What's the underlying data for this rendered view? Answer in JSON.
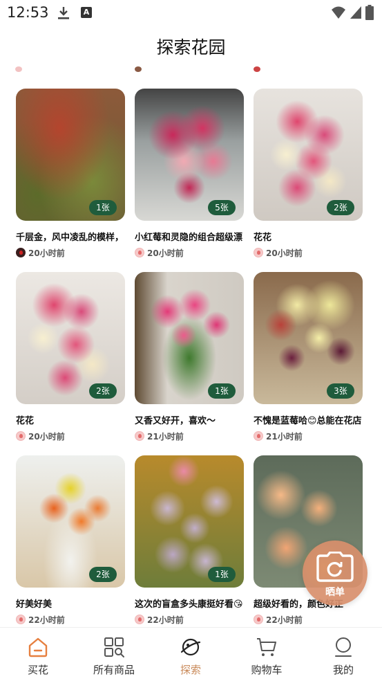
{
  "status_bar": {
    "time": "12:53",
    "notification_icons": [
      "download-icon",
      "a-icon"
    ],
    "system_icons": [
      "wifi-icon",
      "signal-icon",
      "battery-icon"
    ]
  },
  "header": {
    "title": "探索花园"
  },
  "posts": [
    {
      "title": "千层金，风中凌乱的模样，",
      "time": "20小时前",
      "count": "1张",
      "avatar": "dark"
    },
    {
      "title": "小红莓和灵隐的组合超级漂",
      "time": "20小时前",
      "count": "5张",
      "avatar": "pink"
    },
    {
      "title": "花花",
      "time": "20小时前",
      "count": "2张",
      "avatar": "pink"
    },
    {
      "title": "花花",
      "time": "20小时前",
      "count": "2张",
      "avatar": "pink"
    },
    {
      "title": "又香又好开，喜欢～",
      "time": "21小时前",
      "count": "1张",
      "avatar": "pink"
    },
    {
      "title": "不愧是蓝莓哈😊总能在花店",
      "time": "21小时前",
      "count": "3张",
      "avatar": "pink"
    },
    {
      "title": "好美好美",
      "time": "22小时前",
      "count": "2张",
      "avatar": "pink"
    },
    {
      "title": "这次的盲盒多头康挺好看😘",
      "time": "22小时前",
      "count": "1张",
      "avatar": "pink"
    },
    {
      "title": "超级好看的，颜色好正",
      "time": "22小时前",
      "count": "",
      "avatar": "pink"
    }
  ],
  "fab": {
    "label": "晒单",
    "icon": "camera-icon"
  },
  "tabs": [
    {
      "label": "买花",
      "icon": "home-icon",
      "active": false
    },
    {
      "label": "所有商品",
      "icon": "grid-search-icon",
      "active": false
    },
    {
      "label": "探索",
      "icon": "planet-icon",
      "active": true
    },
    {
      "label": "购物车",
      "icon": "cart-icon",
      "active": false
    },
    {
      "label": "我的",
      "icon": "profile-icon",
      "active": false
    }
  ],
  "colors": {
    "accent": "#c98a5a",
    "badge": "#1f5c3c",
    "fab": "#d88f6c"
  }
}
